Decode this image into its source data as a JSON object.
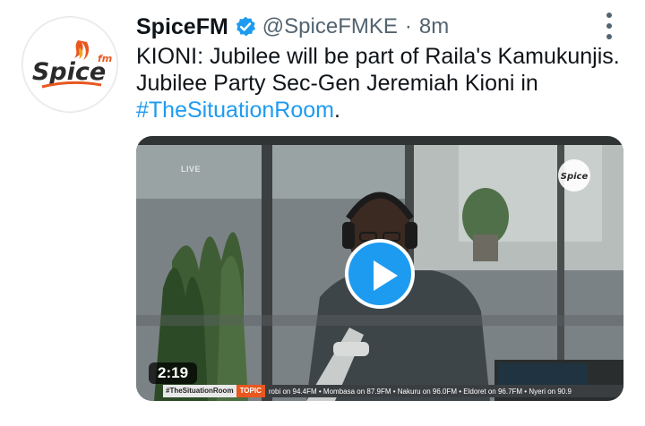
{
  "account": {
    "name": "SpiceFM",
    "handle": "@SpiceFMKE",
    "separator": "·",
    "time": "8m",
    "avatar_logo_text": "Spice",
    "avatar_logo_sub": "fm"
  },
  "tweet": {
    "line1": "KIONI: Jubilee will be part of Raila's Kamukunjis.",
    "line2": "Jubilee Party Sec-Gen Jeremiah Kioni in",
    "hashtag": "#TheSituationRoom",
    "trailing": "."
  },
  "video": {
    "duration": "2:19",
    "overlay_label": "LIVE",
    "watermark_text": "Spice",
    "ticker_tag": "#TheSituationRoom",
    "ticker_topic": "TOPIC",
    "ticker_text": "robi on 94.4FM  •  Mombasa on 87.9FM  •  Nakuru on 96.0FM  •  Eldoret on 96.7FM  •  Nyeri on 90.9"
  },
  "colors": {
    "link": "#1d9bf0",
    "verified": "#1d9bf0",
    "muted": "#536471",
    "brand": "#e8571f"
  },
  "icons": {
    "verified": "verified-badge-icon",
    "more": "more-options-icon",
    "play": "play-icon"
  }
}
